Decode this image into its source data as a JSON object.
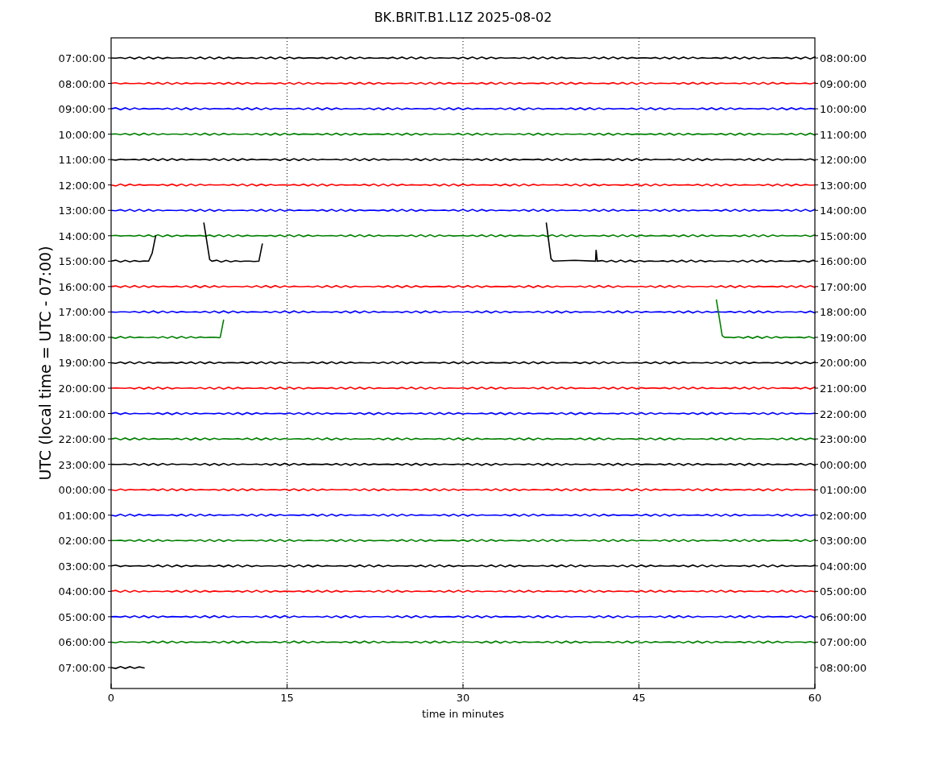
{
  "chart": {
    "title": "BK.BRIT.B1.L1Z 2025-08-02",
    "xlabel": "time in minutes",
    "ylabel": "UTC (local time = UTC - 07:00)",
    "xticks": [
      "0",
      "15",
      "30",
      "45",
      "60"
    ],
    "rows": [
      {
        "utc": "07:00:00",
        "local": "08:00:00",
        "color": "#000000"
      },
      {
        "utc": "08:00:00",
        "local": "09:00:00",
        "color": "#ff0000"
      },
      {
        "utc": "09:00:00",
        "local": "10:00:00",
        "color": "#0000ff"
      },
      {
        "utc": "10:00:00",
        "local": "11:00:00",
        "color": "#008000"
      },
      {
        "utc": "11:00:00",
        "local": "12:00:00",
        "color": "#000000"
      },
      {
        "utc": "12:00:00",
        "local": "13:00:00",
        "color": "#ff0000"
      },
      {
        "utc": "13:00:00",
        "local": "14:00:00",
        "color": "#0000ff"
      },
      {
        "utc": "14:00:00",
        "local": "15:00:00",
        "color": "#008000"
      },
      {
        "utc": "15:00:00",
        "local": "16:00:00",
        "color": "#000000"
      },
      {
        "utc": "16:00:00",
        "local": "17:00:00",
        "color": "#ff0000"
      },
      {
        "utc": "17:00:00",
        "local": "18:00:00",
        "color": "#0000ff"
      },
      {
        "utc": "18:00:00",
        "local": "19:00:00",
        "color": "#008000"
      },
      {
        "utc": "19:00:00",
        "local": "20:00:00",
        "color": "#000000"
      },
      {
        "utc": "20:00:00",
        "local": "21:00:00",
        "color": "#ff0000"
      },
      {
        "utc": "21:00:00",
        "local": "22:00:00",
        "color": "#0000ff"
      },
      {
        "utc": "22:00:00",
        "local": "23:00:00",
        "color": "#008000"
      },
      {
        "utc": "23:00:00",
        "local": "00:00:00",
        "color": "#000000"
      },
      {
        "utc": "00:00:00",
        "local": "01:00:00",
        "color": "#ff0000"
      },
      {
        "utc": "01:00:00",
        "local": "02:00:00",
        "color": "#0000ff"
      },
      {
        "utc": "02:00:00",
        "local": "03:00:00",
        "color": "#008000"
      },
      {
        "utc": "03:00:00",
        "local": "04:00:00",
        "color": "#000000"
      },
      {
        "utc": "04:00:00",
        "local": "05:00:00",
        "color": "#ff0000"
      },
      {
        "utc": "05:00:00",
        "local": "06:00:00",
        "color": "#0000ff"
      },
      {
        "utc": "06:00:00",
        "local": "07:00:00",
        "color": "#008000"
      },
      {
        "utc": "07:00:00",
        "local": "08:00:00",
        "color": "#000000"
      }
    ]
  }
}
